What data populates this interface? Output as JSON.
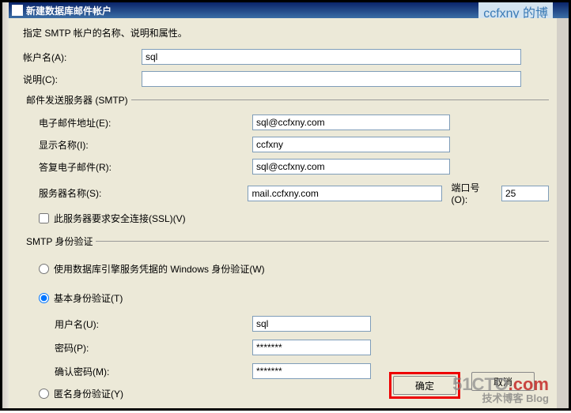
{
  "title": "新建数据库邮件帐户",
  "watermark_top": "ccfxny 的博",
  "instruction": "指定 SMTP 帐户的名称、说明和属性。",
  "labels": {
    "account_name": "帐户名(A):",
    "description": "说明(C):",
    "smtp_group": "邮件发送服务器 (SMTP)",
    "email": "电子邮件地址(E):",
    "display_name": "显示名称(I):",
    "reply_email": "答复电子邮件(R):",
    "server_name": "服务器名称(S):",
    "port": "端口号(O):",
    "ssl": "此服务器要求安全连接(SSL)(V)",
    "auth_group": "SMTP 身份验证",
    "windows_auth": "使用数据库引擎服务凭据的 Windows 身份验证(W)",
    "basic_auth": "基本身份验证(T)",
    "username": "用户名(U):",
    "password": "密码(P):",
    "confirm_password": "确认密码(M):",
    "anon_auth": "匿名身份验证(Y)"
  },
  "values": {
    "account_name": "sql",
    "description": "",
    "email": "sql@ccfxny.com",
    "display_name": "ccfxny",
    "reply_email": "sql@ccfxny.com",
    "server_name": "mail.ccfxny.com",
    "port": "25",
    "ssl_checked": false,
    "auth_mode": "basic",
    "username": "sql",
    "password": "*******",
    "confirm_password": "*******"
  },
  "buttons": {
    "ok": "确定",
    "cancel": "取消"
  },
  "watermark_bottom": {
    "main1": "51CTO",
    "main2": ".com",
    "sub": "技术博客 Blog"
  }
}
